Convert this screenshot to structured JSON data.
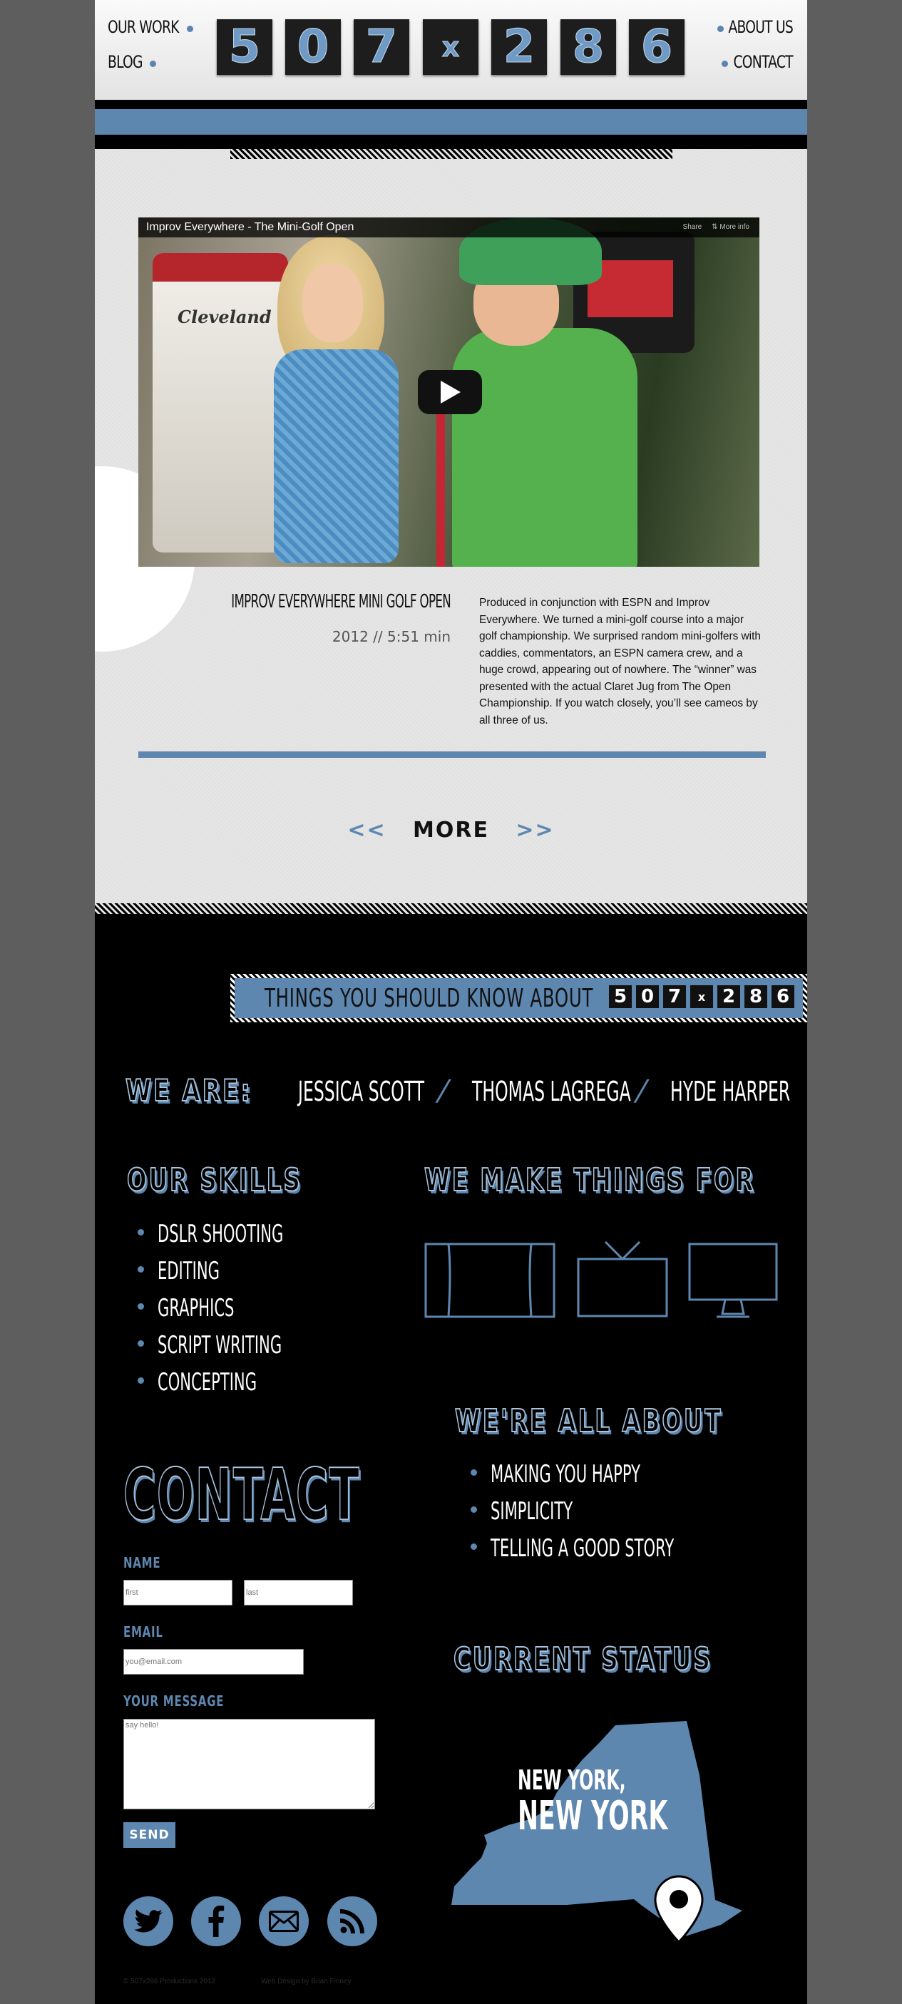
{
  "nav": {
    "our_work": "OUR WORK",
    "blog": "BLOG",
    "about_us": "ABOUT US",
    "contact": "CONTACT"
  },
  "logo": {
    "chars": [
      "5",
      "0",
      "7",
      "x",
      "2",
      "8",
      "6"
    ]
  },
  "video": {
    "player_title": "Improv Everywhere - The Mini-Golf Open",
    "share": "Share",
    "more_info": "More info",
    "title": "IMPROV EVERYWHERE MINI GOLF OPEN",
    "meta": "2012 // 5:51 min",
    "description": "Produced in conjunction with ESPN and Improv Everywhere. We turned a mini-golf course into a major golf championship. We surprised random mini-golfers with caddies, commentators, an ESPN camera crew, and a huge crowd, appearing out of nowhere. The “winner” was presented with the actual Claret Jug from The Open Championship. If you watch closely, you’ll see cameos by all three of us."
  },
  "pager": {
    "prev": "<<",
    "more": "MORE",
    "next": ">>"
  },
  "about": {
    "banner": "THINGS YOU SHOULD KNOW ABOUT",
    "we_are_label": "WE ARE:",
    "members": [
      "JESSICA SCOTT",
      "THOMAS LAGREGA",
      "HYDE HARPER"
    ],
    "skills_heading": "OUR SKILLS",
    "skills": [
      "DSLR SHOOTING",
      "EDITING",
      "GRAPHICS",
      "SCRIPT WRITING",
      "CONCEPTING"
    ],
    "make_heading": "WE MAKE THINGS FOR",
    "about_heading": "WE'RE ALL ABOUT",
    "about_items": [
      "MAKING YOU HAPPY",
      "SIMPLICITY",
      "TELLING A GOOD STORY"
    ],
    "status_heading": "CURRENT STATUS",
    "status_line1": "NEW YORK,",
    "status_line2": "NEW YORK"
  },
  "contact": {
    "heading": "CONTACT",
    "name_label": "NAME",
    "first_placeholder": "first",
    "last_placeholder": "last",
    "email_label": "EMAIL",
    "email_placeholder": "you@email.com",
    "message_label": "YOUR MESSAGE",
    "message_placeholder": "say hello!",
    "send": "SEND"
  },
  "social": [
    "twitter-icon",
    "facebook-icon",
    "email-icon",
    "rss-icon"
  ],
  "footer": {
    "copyright": "© 507x286 Productions 2012",
    "credit": "Web Design by Brian Finney"
  },
  "colors": {
    "accent_blue": "#5e87b0",
    "outline_light": "#a9c4de",
    "background_gray": "#5e5e5e",
    "content_gray": "#e6e6e6"
  }
}
